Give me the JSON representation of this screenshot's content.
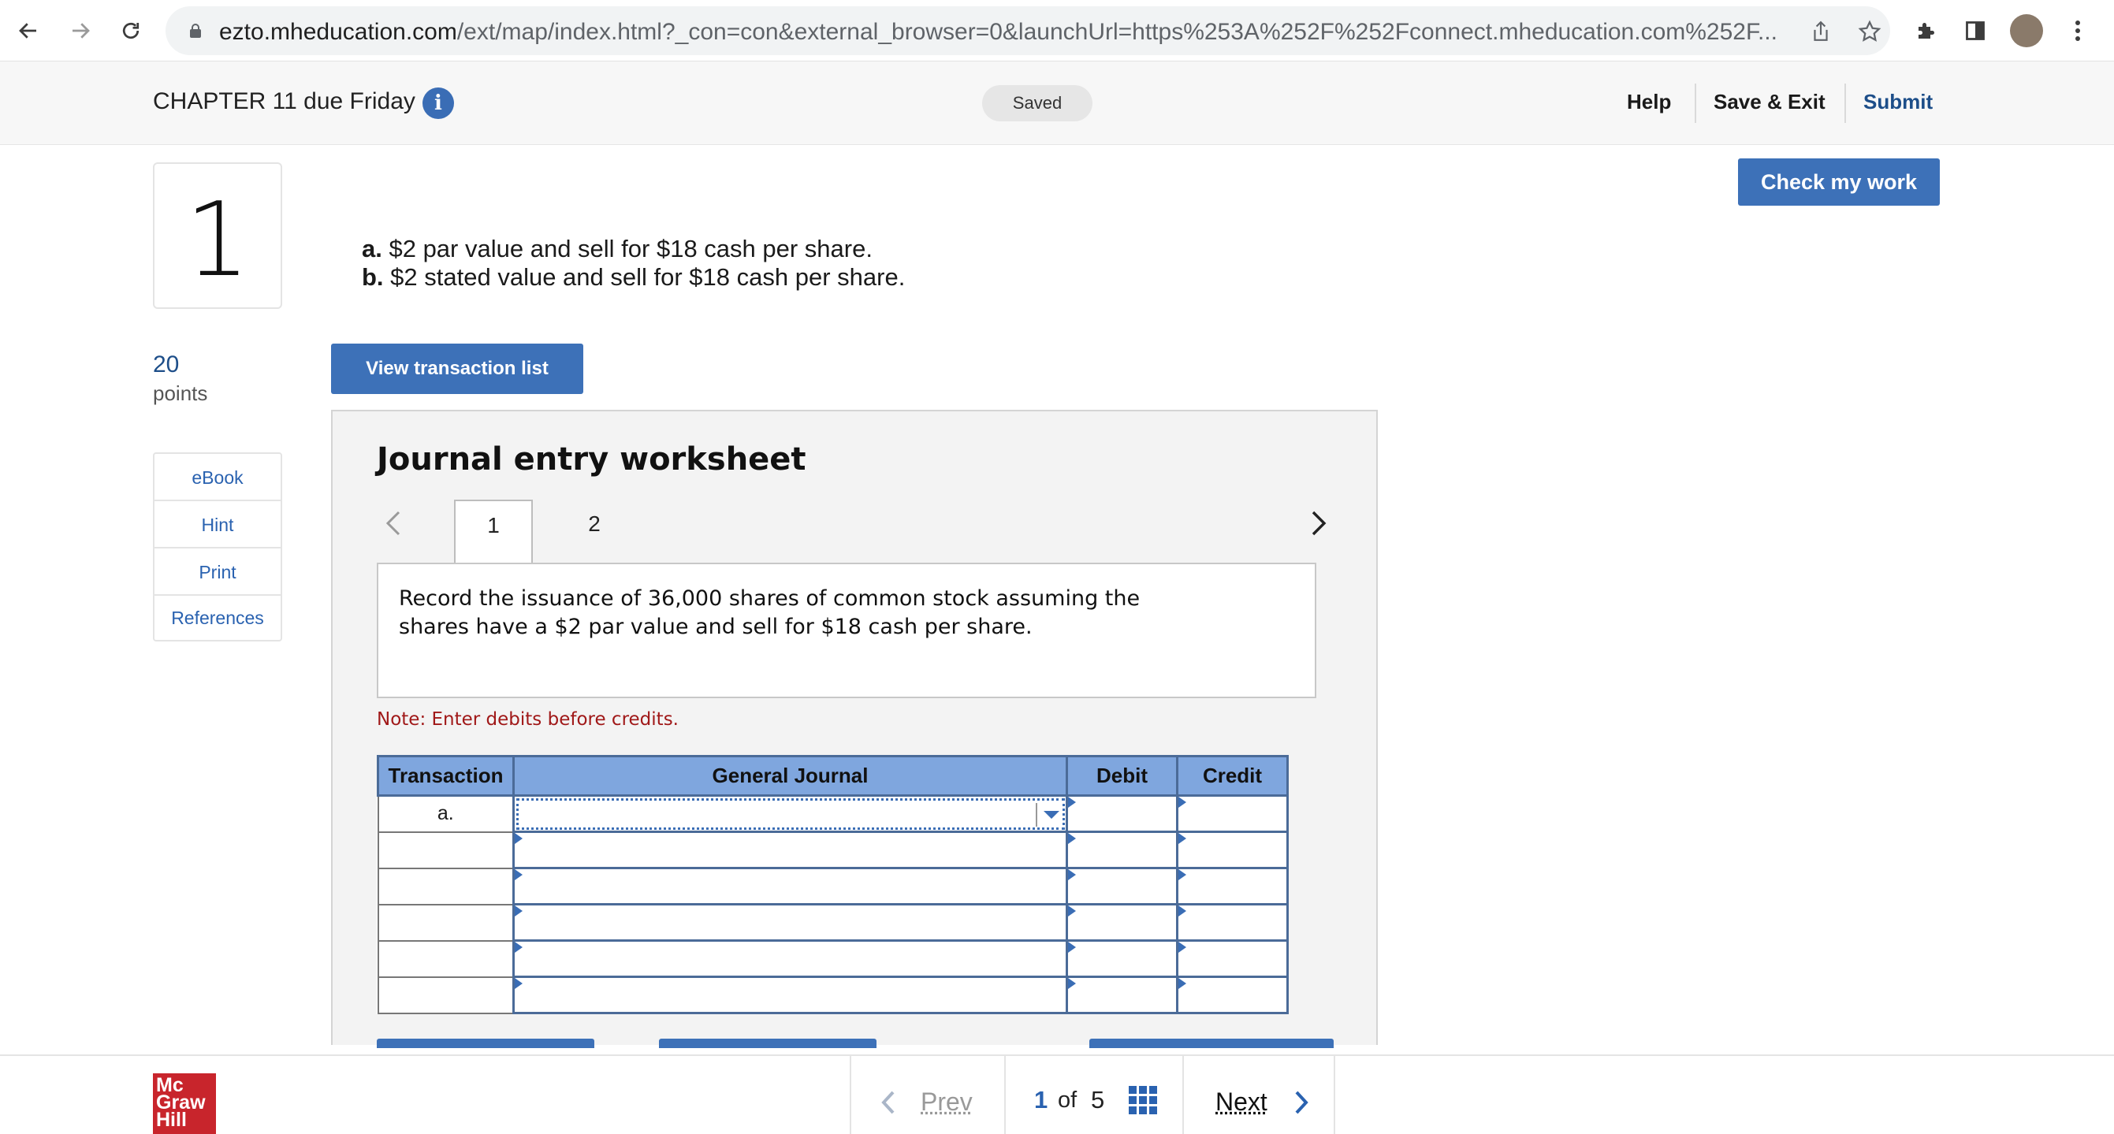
{
  "browser": {
    "url_host": "ezto.mheducation.com",
    "url_rest": "/ext/map/index.html?_con=con&external_browser=0&launchUrl=https%253A%252F%252Fconnect.mheducation.com%252F..."
  },
  "header": {
    "title": "CHAPTER 11 due Friday",
    "saved_label": "Saved",
    "help_label": "Help",
    "save_exit_label": "Save & Exit",
    "submit_label": "Submit"
  },
  "question": {
    "number": "1",
    "points_value": "20",
    "points_label": "points",
    "side_links": [
      "eBook",
      "Hint",
      "Print",
      "References"
    ],
    "check_label": "Check my work",
    "prompt_a_letter": "a.",
    "prompt_a_text": " $2 par value and sell for $18 cash per share.",
    "prompt_b_letter": "b.",
    "prompt_b_text": " $2 stated value and sell for $18 cash per share.",
    "view_transactions_label": "View transaction list"
  },
  "worksheet": {
    "title": "Journal entry worksheet",
    "tabs": [
      "1",
      "2"
    ],
    "instruction": "Record the issuance of 36,000 shares of common stock assuming the shares have a $2 par value and sell for $18 cash per share.",
    "note": "Note: Enter debits before credits.",
    "columns": [
      "Transaction",
      "General Journal",
      "Debit",
      "Credit"
    ],
    "rows": [
      {
        "transaction": "a.",
        "account": "",
        "debit": "",
        "credit": ""
      },
      {
        "transaction": "",
        "account": "",
        "debit": "",
        "credit": ""
      },
      {
        "transaction": "",
        "account": "",
        "debit": "",
        "credit": ""
      },
      {
        "transaction": "",
        "account": "",
        "debit": "",
        "credit": ""
      },
      {
        "transaction": "",
        "account": "",
        "debit": "",
        "credit": ""
      },
      {
        "transaction": "",
        "account": "",
        "debit": "",
        "credit": ""
      }
    ]
  },
  "footer": {
    "logo_line1": "Mc",
    "logo_line2": "Graw",
    "logo_line3": "Hill",
    "prev_label": "Prev",
    "current_page": "1",
    "of_label": "of",
    "total_pages": "5",
    "next_label": "Next"
  },
  "colors": {
    "accent": "#3d71b8",
    "table_header": "#7fa6de",
    "note": "#a01818",
    "logo": "#c8252c"
  }
}
